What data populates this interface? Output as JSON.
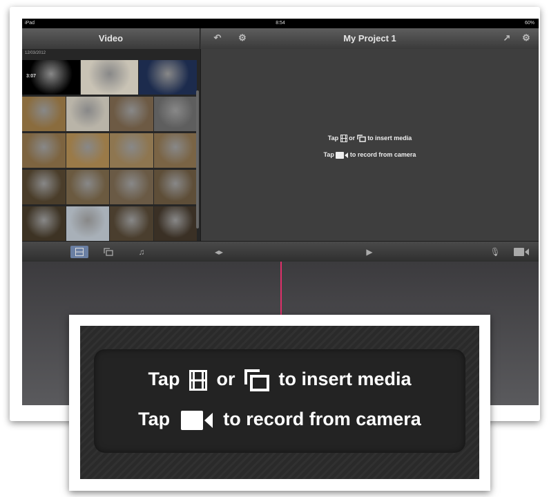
{
  "statusbar": {
    "device": "iPad",
    "time": "8:54",
    "battery": "60%"
  },
  "nav": {
    "browser_title": "Video",
    "project_title": "My Project 1"
  },
  "browser": {
    "date_label": "12/03/2012",
    "first_clip_duration": "3:07",
    "thumb_rows": [
      [
        "#000000",
        "#c9c3b5",
        "#1c2b4d"
      ],
      [
        "#8a6c3e",
        "#b9b4a8",
        "#6d5a44",
        "#5e5e5e"
      ],
      [
        "#7d6440",
        "#9a7a48",
        "#8e7650",
        "#7a6445"
      ],
      [
        "#4a3d2a",
        "#6b5a40",
        "#6a5a45",
        "#5e4e38"
      ],
      [
        "#3d3324",
        "#a8b0b8",
        "#4a3e2e",
        "#3a3025"
      ]
    ]
  },
  "viewer": {
    "hint_line1_a": "Tap",
    "hint_line1_b": "or",
    "hint_line1_c": "to insert media",
    "hint_line2_a": "Tap",
    "hint_line2_b": "to record from camera"
  },
  "callout": {
    "line1_a": "Tap",
    "line1_b": "or",
    "line1_c": "to insert media",
    "line2_a": "Tap",
    "line2_b": "to record from camera"
  },
  "icons": {
    "video_browser": "film-icon",
    "photo_browser": "photos-icon",
    "audio_browser": "music-note-icon",
    "camera": "video-camera-icon"
  },
  "colors": {
    "playhead": "#e0306a",
    "active_tab": "#6a7fa3"
  }
}
